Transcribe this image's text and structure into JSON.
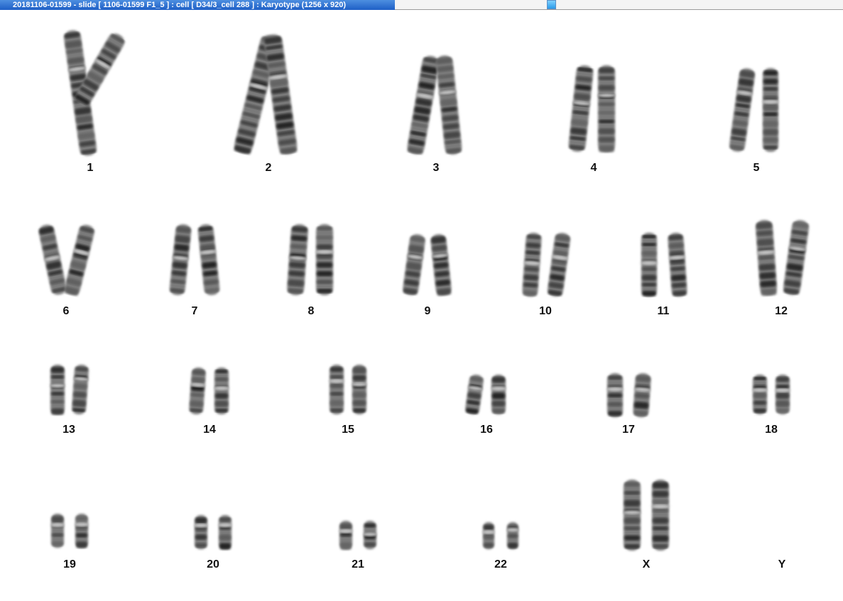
{
  "window": {
    "title": "20181106-01599 - slide [ 1106-01599 F1_5 ] : cell [ D34/3_cell 288 ] : Karyotype  (1256 x 920)"
  },
  "karyotype": {
    "chromosomes": [
      {
        "label": "1",
        "count": 2
      },
      {
        "label": "2",
        "count": 2
      },
      {
        "label": "3",
        "count": 2
      },
      {
        "label": "4",
        "count": 2
      },
      {
        "label": "5",
        "count": 2
      },
      {
        "label": "6",
        "count": 2
      },
      {
        "label": "7",
        "count": 2
      },
      {
        "label": "8",
        "count": 2
      },
      {
        "label": "9",
        "count": 2
      },
      {
        "label": "10",
        "count": 2
      },
      {
        "label": "11",
        "count": 2
      },
      {
        "label": "12",
        "count": 2
      },
      {
        "label": "13",
        "count": 2
      },
      {
        "label": "14",
        "count": 2
      },
      {
        "label": "15",
        "count": 2
      },
      {
        "label": "16",
        "count": 2
      },
      {
        "label": "17",
        "count": 2
      },
      {
        "label": "18",
        "count": 2
      },
      {
        "label": "19",
        "count": 2
      },
      {
        "label": "20",
        "count": 2
      },
      {
        "label": "21",
        "count": 2
      },
      {
        "label": "22",
        "count": 2
      },
      {
        "label": "X",
        "count": 2
      },
      {
        "label": "Y",
        "count": 0
      }
    ]
  }
}
